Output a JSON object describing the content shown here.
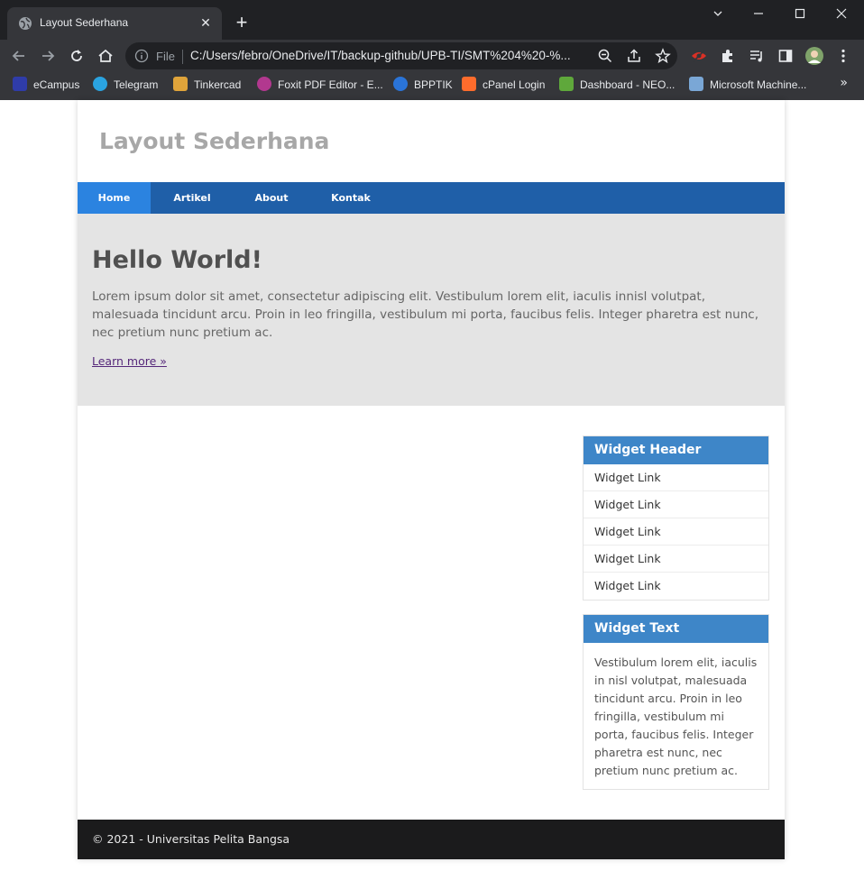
{
  "browser": {
    "tab_title": "Layout Sederhana",
    "omnibox_scheme": "File",
    "url": "C:/Users/febro/OneDrive/IT/backup-github/UPB-TI/SMT%204%20-%...",
    "bookmarks": [
      {
        "label": "eCampus",
        "color": "#2f3ca8"
      },
      {
        "label": "Telegram",
        "color": "#2aa3e0"
      },
      {
        "label": "Tinkercad",
        "color": "#e0a43a"
      },
      {
        "label": "Foxit PDF Editor - E...",
        "color": "#b2388f"
      },
      {
        "label": "BPPTIK",
        "color": "#2a74d8"
      },
      {
        "label": "cPanel Login",
        "color": "#ff6c2c"
      },
      {
        "label": "Dashboard - NEO...",
        "color": "#5fa83b"
      },
      {
        "label": "Microsoft Machine...",
        "color": "#7aa7d6"
      }
    ]
  },
  "site": {
    "title": "Layout Sederhana",
    "nav": [
      "Home",
      "Artikel",
      "About",
      "Kontak"
    ],
    "hero": {
      "title": "Hello World!",
      "text": "Lorem ipsum dolor sit amet, consectetur adipiscing elit. Vestibulum lorem elit, iaculis innisl volutpat, malesuada tincidunt arcu. Proin in leo fringilla, vestibulum mi porta, faucibus felis. Integer pharetra est nunc, nec pretium nunc pretium ac.",
      "link": "Learn more »"
    },
    "widget1": {
      "header": "Widget Header",
      "links": [
        "Widget Link",
        "Widget Link",
        "Widget Link",
        "Widget Link",
        "Widget Link"
      ]
    },
    "widget2": {
      "header": "Widget Text",
      "text": "Vestibulum lorem elit, iaculis in nisl volutpat, malesuada tincidunt arcu. Proin in leo fringilla, vestibulum mi porta, faucibus felis. Integer pharetra est nunc, nec pretium nunc pretium ac."
    },
    "footer": "© 2021 - Universitas Pelita Bangsa"
  },
  "colors": {
    "nav_bg": "#1f5fa8",
    "nav_active": "#2b83e0",
    "widget_header": "#3e86c8",
    "hero_bg": "#e4e4e4",
    "footer_bg": "#1b1b1c"
  }
}
